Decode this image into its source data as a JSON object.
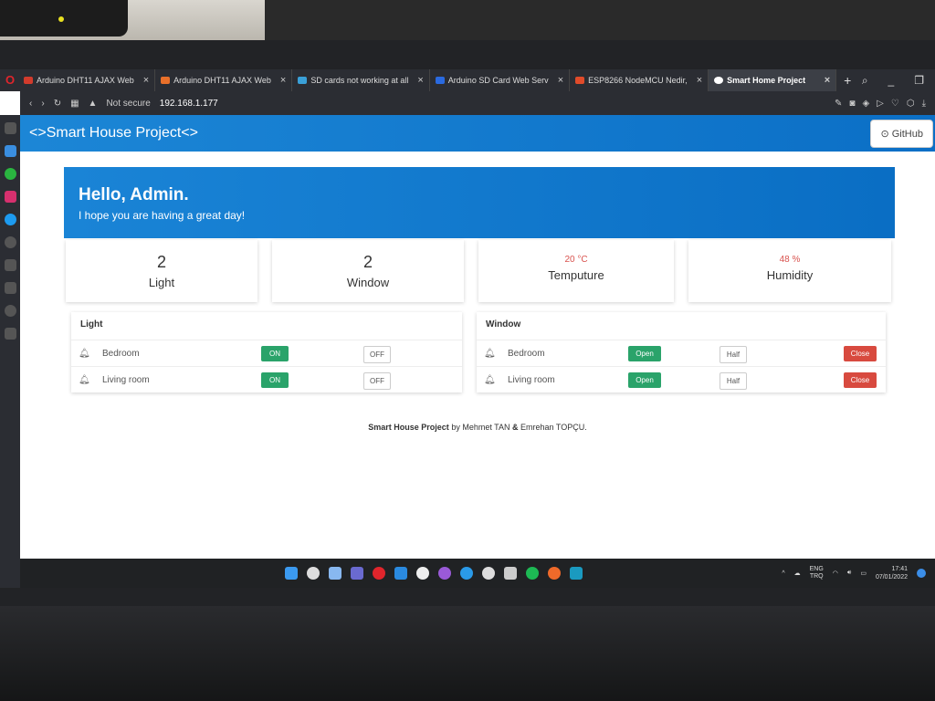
{
  "browser": {
    "tabs": [
      {
        "label": "Arduino DHT11 AJAX Web",
        "color": "#d23b2c"
      },
      {
        "label": "Arduino DHT11 AJAX Web",
        "color": "#e8702a"
      },
      {
        "label": "SD cards not working at all",
        "color": "#3aa0d8"
      },
      {
        "label": "Arduino SD Card Web Serv",
        "color": "#2a6ae0"
      },
      {
        "label": "ESP8266 NodeMCU Nedir,",
        "color": "#e04b2a"
      },
      {
        "label": "Smart Home Project",
        "color": "#ffffff"
      }
    ],
    "security": "Not secure",
    "url": "192.168.1.177"
  },
  "navbar": {
    "brand": "<>Smart House Project<>",
    "github": "GitHub"
  },
  "hero": {
    "title": "Hello, Admin.",
    "subtitle": "I hope you are having a great day!"
  },
  "stats": [
    {
      "value": "2",
      "label": "Light"
    },
    {
      "value": "2",
      "label": "Window"
    },
    {
      "value": "20 °C",
      "label": "Temputure"
    },
    {
      "value": "48 %",
      "label": "Humidity"
    }
  ],
  "light": {
    "title": "Light",
    "rows": [
      {
        "room": "Bedroom",
        "on": "ON",
        "off": "OFF"
      },
      {
        "room": "Living room",
        "on": "ON",
        "off": "OFF"
      }
    ]
  },
  "window": {
    "title": "Window",
    "rows": [
      {
        "room": "Bedroom",
        "open": "Open",
        "half": "Half",
        "close": "Close"
      },
      {
        "room": "Living room",
        "open": "Open",
        "half": "Half",
        "close": "Close"
      }
    ]
  },
  "footer": {
    "project": "Smart House Project",
    "by": "by Mehmet TAN",
    "amp": "&",
    "author2": "Emrehan TOPÇU."
  },
  "taskbar": {
    "lang": "ENG",
    "region": "TRQ",
    "time": "17:41",
    "date": "07/01/2022"
  }
}
